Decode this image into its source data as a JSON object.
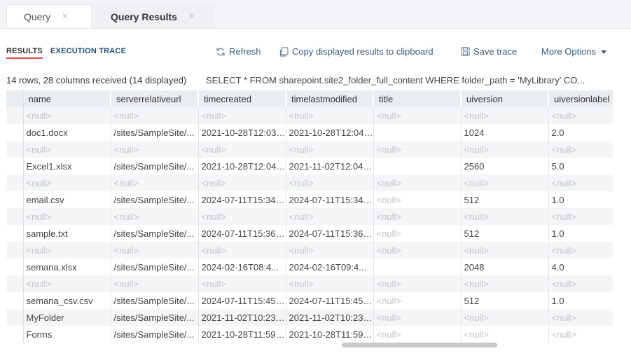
{
  "tabs": [
    {
      "label": "Query",
      "close": "×"
    },
    {
      "label": "Query Results",
      "close": "×"
    }
  ],
  "subtabs": {
    "results": "RESULTS",
    "trace": "EXECUTION TRACE"
  },
  "toolbar": {
    "refresh": "Refresh",
    "copy": "Copy displayed results to clipboard",
    "save": "Save trace",
    "more": "More Options"
  },
  "summary": "14 rows, 28 columns received (14 displayed)",
  "query": "SELECT * FROM sharepoint.site2_folder_full_content WHERE folder_path = 'MyLibrary' CO...",
  "columns": [
    "name",
    "serverrelativeurl",
    "timecreated",
    "timelastmodified",
    "title",
    "uiversion",
    "uiversionlabel"
  ],
  "rows": [
    [
      "<null>",
      "<null>",
      "<null>",
      "<null>",
      "<null>",
      "<null>",
      "<null>"
    ],
    [
      "doc1.docx",
      "/sites/SampleSite/...",
      "2021-10-28T12:03:...",
      "2021-10-28T12:04:...",
      "",
      "1024",
      "2.0"
    ],
    [
      "<null>",
      "<null>",
      "<null>",
      "<null>",
      "<null>",
      "<null>",
      "<null>"
    ],
    [
      "Excel1.xlsx",
      "/sites/SampleSite/...",
      "2021-10-28T12:04:...",
      "2021-11-02T12:04:...",
      "",
      "2560",
      "5.0"
    ],
    [
      "<null>",
      "<null>",
      "<null>",
      "<null>",
      "<null>",
      "<null>",
      "<null>"
    ],
    [
      "email.csv",
      "/sites/SampleSite/...",
      "2024-07-11T15:34:...",
      "2024-07-11T15:34:...",
      "<null>",
      "512",
      "1.0"
    ],
    [
      "<null>",
      "<null>",
      "<null>",
      "<null>",
      "<null>",
      "<null>",
      "<null>"
    ],
    [
      "sample.txt",
      "/sites/SampleSite/...",
      "2024-07-11T15:36:...",
      "2024-07-11T15:36:...",
      "<null>",
      "512",
      "1.0"
    ],
    [
      "<null>",
      "<null>",
      "<null>",
      "<null>",
      "<null>",
      "<null>",
      "<null>"
    ],
    [
      "semana.xlsx",
      "/sites/SampleSite/...",
      "2024-02-16T08:4...",
      "2024-02-16T09:4...",
      "",
      "2048",
      "4.0"
    ],
    [
      "<null>",
      "<null>",
      "<null>",
      "<null>",
      "<null>",
      "<null>",
      "<null>"
    ],
    [
      "semana_csv.csv",
      "/sites/SampleSite/...",
      "2024-07-11T15:45:...",
      "2024-07-11T15:45:...",
      "<null>",
      "512",
      "1.0"
    ],
    [
      "MyFolder",
      "/sites/SampleSite/...",
      "2021-11-02T10:23:...",
      "2021-11-02T10:23:...",
      "<null>",
      "<null>",
      "<null>"
    ],
    [
      "Forms",
      "/sites/SampleSite/...",
      "2021-10-28T11:59:...",
      "2021-10-28T11:59:...",
      "<null>",
      "<null>",
      "<null>"
    ]
  ]
}
